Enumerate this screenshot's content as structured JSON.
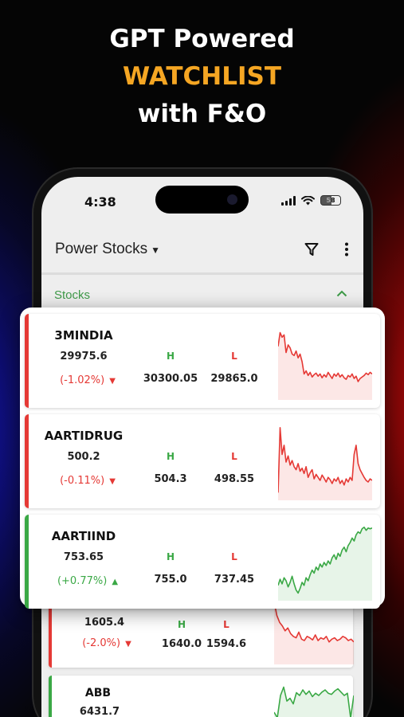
{
  "headline": {
    "line1": "GPT Powered",
    "line2": "WATCHLIST",
    "line3": "with F&O"
  },
  "status_bar": {
    "time": "4:38",
    "battery": "58"
  },
  "app_bar": {
    "title": "Power Stocks",
    "icons": [
      "filter-icon",
      "more-vert-icon"
    ]
  },
  "section": {
    "label": "Stocks",
    "icon": "chevron-up-icon"
  },
  "labels": {
    "high": "H",
    "low": "L"
  },
  "colors": {
    "up": "#3aa845",
    "down": "#e53935",
    "accent": "#f5a623"
  },
  "stocks": [
    {
      "symbol": "3MINDIA",
      "price": "29975.6",
      "change": "(-1.02%)",
      "direction": "down",
      "high": "30300.05",
      "low": "29865.0",
      "spark": [
        70,
        88,
        82,
        85,
        62,
        72,
        68,
        60,
        58,
        64,
        55,
        60,
        50,
        34,
        38,
        32,
        36,
        30,
        33,
        35,
        31,
        34,
        29,
        33,
        30,
        36,
        32,
        28,
        34,
        31,
        35,
        30,
        33,
        29,
        27,
        32,
        30,
        34,
        28,
        31,
        24,
        28,
        30,
        32,
        35,
        33,
        36,
        34
      ]
    },
    {
      "symbol": "AARTIDRUG",
      "price": "500.2",
      "change": "(-0.11%)",
      "direction": "down",
      "high": "504.3",
      "low": "498.55",
      "spark": [
        10,
        95,
        60,
        72,
        50,
        58,
        46,
        52,
        44,
        40,
        48,
        38,
        42,
        35,
        44,
        30,
        36,
        40,
        28,
        34,
        30,
        26,
        33,
        29,
        24,
        30,
        27,
        22,
        28,
        25,
        30,
        22,
        26,
        20,
        28,
        24,
        30,
        26,
        60,
        72,
        48,
        40,
        35,
        30,
        26,
        24,
        28,
        26
      ]
    },
    {
      "symbol": "AARTIIND",
      "price": "753.65",
      "change": "(+0.77%)",
      "direction": "up",
      "high": "755.0",
      "low": "737.45",
      "spark": [
        20,
        28,
        22,
        30,
        26,
        18,
        24,
        32,
        22,
        14,
        10,
        16,
        24,
        20,
        30,
        26,
        34,
        40,
        36,
        44,
        40,
        48,
        44,
        50,
        46,
        52,
        48,
        56,
        60,
        54,
        62,
        58,
        66,
        70,
        64,
        72,
        76,
        82,
        78,
        86,
        90,
        88,
        94,
        96,
        92,
        95,
        94,
        95
      ]
    }
  ],
  "background_stocks": [
    {
      "symbol": "",
      "price": "1605.4",
      "change": "(-2.0%)",
      "direction": "down",
      "high": "1640.0",
      "low": "1594.6",
      "spark": [
        90,
        70,
        60,
        55,
        48,
        52,
        44,
        40,
        38,
        46,
        36,
        34,
        40,
        38,
        35,
        42,
        34,
        38,
        36,
        40,
        32,
        36,
        38,
        34,
        36,
        40,
        38,
        34,
        36,
        32
      ]
    },
    {
      "symbol": "ABB",
      "price": "6431.7",
      "change": "",
      "direction": "up",
      "high": "",
      "low": "",
      "spark": [
        40,
        30,
        70,
        85,
        60,
        65,
        55,
        75,
        70,
        80,
        72,
        78,
        68,
        74,
        70,
        76,
        80,
        74,
        72,
        78,
        82,
        76,
        70,
        74,
        30,
        70
      ]
    }
  ]
}
